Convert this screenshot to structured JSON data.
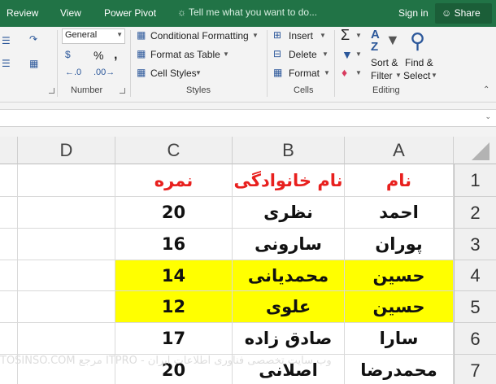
{
  "tabs": [
    "Review",
    "View",
    "Power Pivot"
  ],
  "tell_me": "Tell me what you want to do...",
  "sign_in": "Sign in",
  "share": "Share",
  "ribbon": {
    "number": {
      "format": "General",
      "currency_symbol": "$",
      "percent_symbol": "%",
      "comma_symbol": ",",
      "label": "Number"
    },
    "styles": {
      "conditional": "Conditional Formatting",
      "format_table": "Format as Table",
      "cell_styles": "Cell Styles",
      "label": "Styles"
    },
    "cells": {
      "insert": "Insert",
      "delete": "Delete",
      "format": "Format",
      "label": "Cells"
    },
    "editing": {
      "sort_line1": "Sort &",
      "sort_line2": "Filter",
      "find_line1": "Find &",
      "find_line2": "Select",
      "label": "Editing"
    }
  },
  "columns": [
    "A",
    "B",
    "C",
    "D"
  ],
  "rows": [
    "1",
    "2",
    "3",
    "4",
    "5",
    "6",
    "7"
  ],
  "cells": [
    {
      "a": "نام",
      "b": "نام خانوادگی",
      "c": "نمره"
    },
    {
      "a": "احمد",
      "b": "نظری",
      "c": "20"
    },
    {
      "a": "پوران",
      "b": "سارونی",
      "c": "16"
    },
    {
      "a": "حسین",
      "b": "محمدیانی",
      "c": "14"
    },
    {
      "a": "حسین",
      "b": "علوی",
      "c": "12"
    },
    {
      "a": "سارا",
      "b": "صادق زاده",
      "c": "17"
    },
    {
      "a": "محمدرضا",
      "b": "اصلانی",
      "c": "20"
    }
  ],
  "header_color": "#e8201e",
  "highlight_color": "#ffff00",
  "watermark": "TOSINSO.COM مرجع ITPRO - وب سایت تخصصی فناوری اطلاعات ایران"
}
